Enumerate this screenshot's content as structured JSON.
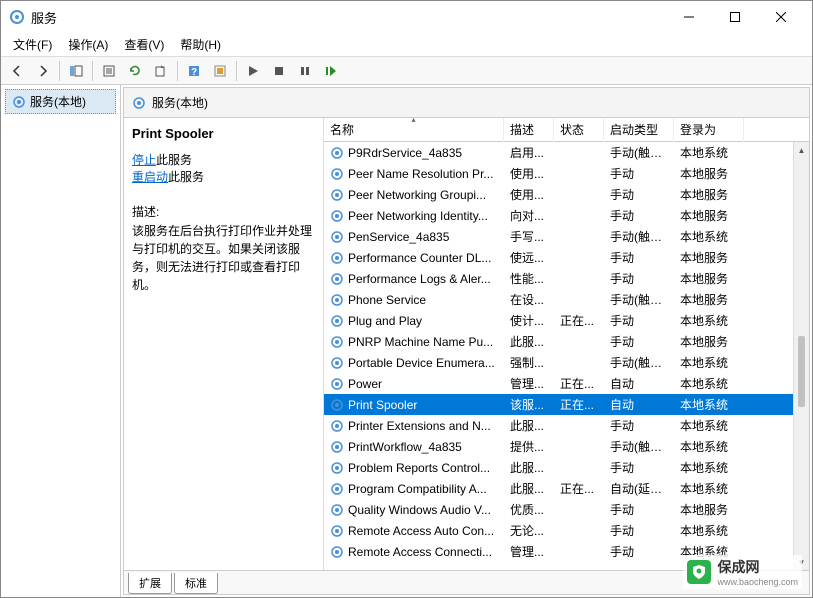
{
  "window": {
    "title": "服务"
  },
  "menus": {
    "file": "文件(F)",
    "action": "操作(A)",
    "view": "查看(V)",
    "help": "帮助(H)"
  },
  "tree": {
    "root": "服务(本地)"
  },
  "panel_header": "服务(本地)",
  "detail": {
    "title": "Print Spooler",
    "stop_link": "停止",
    "stop_suffix": "此服务",
    "restart_link": "重启动",
    "restart_suffix": "此服务",
    "desc_label": "描述:",
    "desc": "该服务在后台执行打印作业并处理与打印机的交互。如果关闭该服务，则无法进行打印或查看打印机。"
  },
  "columns": {
    "name": "名称",
    "desc": "描述",
    "status": "状态",
    "startup": "启动类型",
    "logon": "登录为"
  },
  "services": [
    {
      "name": "P9RdrService_4a835",
      "desc": "启用...",
      "status": "",
      "startup": "手动(触发...",
      "logon": "本地系统"
    },
    {
      "name": "Peer Name Resolution Pr...",
      "desc": "使用...",
      "status": "",
      "startup": "手动",
      "logon": "本地服务"
    },
    {
      "name": "Peer Networking Groupi...",
      "desc": "使用...",
      "status": "",
      "startup": "手动",
      "logon": "本地服务"
    },
    {
      "name": "Peer Networking Identity...",
      "desc": "向对...",
      "status": "",
      "startup": "手动",
      "logon": "本地服务"
    },
    {
      "name": "PenService_4a835",
      "desc": "手写...",
      "status": "",
      "startup": "手动(触发...",
      "logon": "本地系统"
    },
    {
      "name": "Performance Counter DL...",
      "desc": "使远...",
      "status": "",
      "startup": "手动",
      "logon": "本地服务"
    },
    {
      "name": "Performance Logs & Aler...",
      "desc": "性能...",
      "status": "",
      "startup": "手动",
      "logon": "本地服务"
    },
    {
      "name": "Phone Service",
      "desc": "在设...",
      "status": "",
      "startup": "手动(触发...",
      "logon": "本地服务"
    },
    {
      "name": "Plug and Play",
      "desc": "使计...",
      "status": "正在...",
      "startup": "手动",
      "logon": "本地系统"
    },
    {
      "name": "PNRP Machine Name Pu...",
      "desc": "此服...",
      "status": "",
      "startup": "手动",
      "logon": "本地服务"
    },
    {
      "name": "Portable Device Enumera...",
      "desc": "强制...",
      "status": "",
      "startup": "手动(触发...",
      "logon": "本地系统"
    },
    {
      "name": "Power",
      "desc": "管理...",
      "status": "正在...",
      "startup": "自动",
      "logon": "本地系统"
    },
    {
      "name": "Print Spooler",
      "desc": "该服...",
      "status": "正在...",
      "startup": "自动",
      "logon": "本地系统",
      "selected": true
    },
    {
      "name": "Printer Extensions and N...",
      "desc": "此服...",
      "status": "",
      "startup": "手动",
      "logon": "本地系统"
    },
    {
      "name": "PrintWorkflow_4a835",
      "desc": "提供...",
      "status": "",
      "startup": "手动(触发...",
      "logon": "本地系统"
    },
    {
      "name": "Problem Reports Control...",
      "desc": "此服...",
      "status": "",
      "startup": "手动",
      "logon": "本地系统"
    },
    {
      "name": "Program Compatibility A...",
      "desc": "此服...",
      "status": "正在...",
      "startup": "自动(延迟...",
      "logon": "本地系统"
    },
    {
      "name": "Quality Windows Audio V...",
      "desc": "优质...",
      "status": "",
      "startup": "手动",
      "logon": "本地服务"
    },
    {
      "name": "Remote Access Auto Con...",
      "desc": "无论...",
      "status": "",
      "startup": "手动",
      "logon": "本地系统"
    },
    {
      "name": "Remote Access Connecti...",
      "desc": "管理...",
      "status": "",
      "startup": "手动",
      "logon": "本地系统"
    }
  ],
  "tabs": {
    "extended": "扩展",
    "standard": "标准"
  },
  "watermark": {
    "name": "保成网",
    "url": "www.baocheng.com"
  }
}
